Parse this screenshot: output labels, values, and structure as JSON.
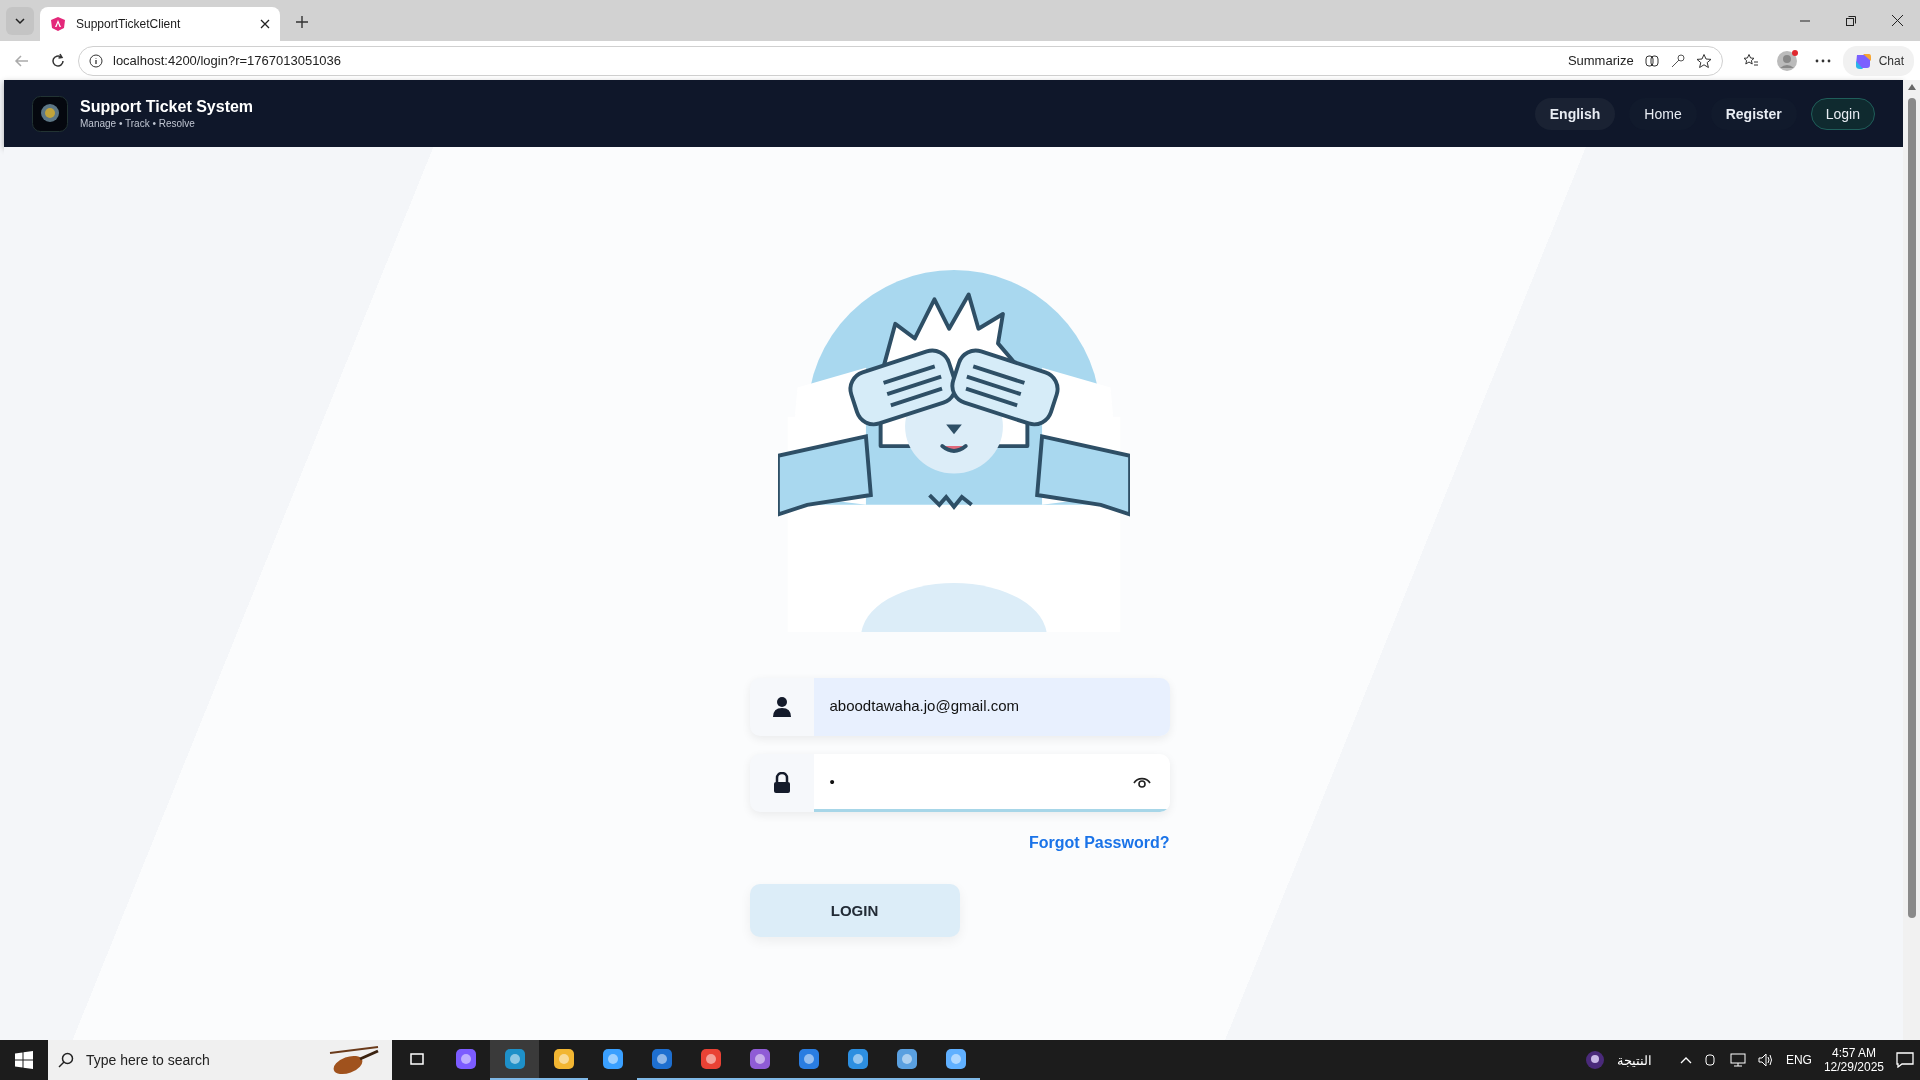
{
  "browser": {
    "tab": {
      "title": "SupportTicketClient",
      "selected": true
    },
    "address": "localhost:4200/login?r=1767013051036",
    "summarize": "Summarize",
    "chat": "Chat"
  },
  "header": {
    "title": "Support Ticket System",
    "subtitle": "Manage • Track • Resolve",
    "nav": [
      {
        "label": "English",
        "kind": "pill"
      },
      {
        "label": "Home",
        "kind": "plain"
      },
      {
        "label": "Register",
        "kind": "bold"
      },
      {
        "label": "Login",
        "kind": "outlined"
      }
    ]
  },
  "form": {
    "email": {
      "value": "aboodtawaha.jo@gmail.com",
      "autofilled": true
    },
    "password": {
      "value": "•",
      "focused": true
    },
    "forgot": "Forgot Password?",
    "submit": "LOGIN"
  },
  "taskbar": {
    "search_placeholder": "Type here to search",
    "apps": [
      {
        "running": false,
        "selected": false
      },
      {
        "running": false,
        "selected": false
      },
      {
        "running": true,
        "selected": true
      },
      {
        "running": true,
        "selected": false
      },
      {
        "running": false,
        "selected": false
      },
      {
        "running": true,
        "selected": false
      },
      {
        "running": true,
        "selected": false
      },
      {
        "running": true,
        "selected": false
      },
      {
        "running": true,
        "selected": false
      },
      {
        "running": true,
        "selected": false
      },
      {
        "running": true,
        "selected": false
      },
      {
        "running": true,
        "selected": false
      }
    ],
    "weather": "النتيجة",
    "language": "ENG",
    "time": "4:57 AM",
    "date": "12/29/2025"
  }
}
